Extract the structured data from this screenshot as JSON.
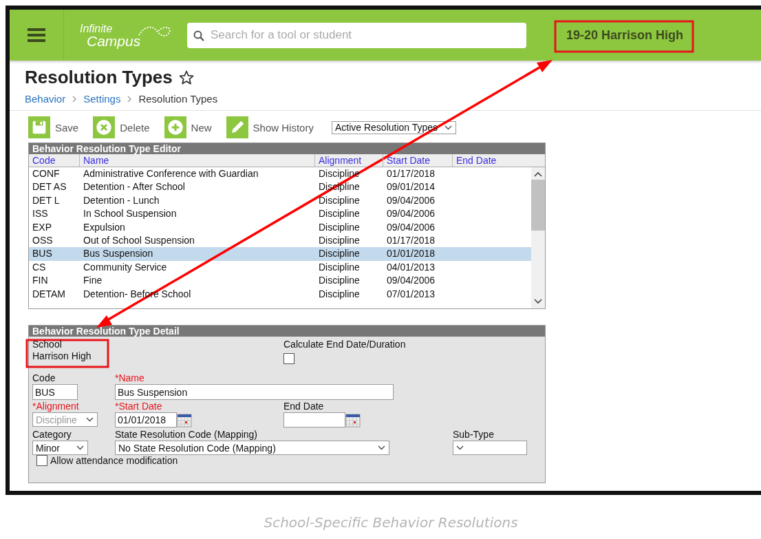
{
  "header": {
    "logo": {
      "line1": "Infinite",
      "line2": "Campus"
    },
    "search": {
      "placeholder": "Search for a tool or student"
    },
    "context": "19-20 Harrison High"
  },
  "page": {
    "title": "Resolution Types",
    "breadcrumb": [
      {
        "label": "Behavior",
        "link": true
      },
      {
        "label": "Settings",
        "link": true
      },
      {
        "label": "Resolution Types",
        "link": false
      }
    ]
  },
  "toolbar": {
    "buttons": [
      {
        "kind": "save",
        "label": "Save"
      },
      {
        "kind": "delete",
        "label": "Delete"
      },
      {
        "kind": "new",
        "label": "New"
      },
      {
        "kind": "history",
        "label": "Show History"
      }
    ],
    "filter": "Active Resolution Types"
  },
  "editor": {
    "title": "Behavior Resolution Type Editor",
    "columns": [
      "Code",
      "Name",
      "Alignment",
      "Start Date",
      "End Date"
    ],
    "rows": [
      {
        "cells": [
          "CONF",
          "Administrative Conference with Guardian",
          "Discipline",
          "01/17/2018"
        ],
        "selected": false
      },
      {
        "cells": [
          "DET AS",
          "Detention - After School",
          "Discipline",
          "09/01/2014"
        ],
        "selected": false
      },
      {
        "cells": [
          "DET L",
          "Detention - Lunch",
          "Discipline",
          "09/04/2006"
        ],
        "selected": false
      },
      {
        "cells": [
          "ISS",
          "In School Suspension",
          "Discipline",
          "09/04/2006"
        ],
        "selected": false
      },
      {
        "cells": [
          "EXP",
          "Expulsion",
          "Discipline",
          "09/04/2006"
        ],
        "selected": false
      },
      {
        "cells": [
          "OSS",
          "Out of School Suspension",
          "Discipline",
          "01/17/2018"
        ],
        "selected": false
      },
      {
        "cells": [
          "BUS",
          "Bus Suspension",
          "Discipline",
          "01/01/2018"
        ],
        "selected": true
      },
      {
        "cells": [
          "CS",
          "Community Service",
          "Discipline",
          "04/01/2013"
        ],
        "selected": false
      },
      {
        "cells": [
          "FIN",
          "Fine",
          "Discipline",
          "09/04/2006"
        ],
        "selected": false
      },
      {
        "cells": [
          "DETAM",
          "Detention- Before School",
          "Discipline",
          "07/01/2013"
        ],
        "selected": false
      }
    ]
  },
  "detail": {
    "title": "Behavior Resolution Type Detail",
    "school": {
      "label": "School",
      "value": "Harrison High"
    },
    "calculate": {
      "label": "Calculate End Date/Duration",
      "checked": false
    },
    "code": {
      "label": "Code",
      "value": "BUS",
      "required": false
    },
    "name": {
      "label": "*Name",
      "value": "Bus Suspension",
      "required": true
    },
    "alignment": {
      "label": "*Alignment",
      "value": "Discipline",
      "required": true,
      "disabled": true
    },
    "start_date": {
      "label": "*Start Date",
      "value": "01/01/2018",
      "required": true
    },
    "end_date": {
      "label": "End Date",
      "required": false
    },
    "category": {
      "label": "Category",
      "value": "Minor",
      "required": false
    },
    "state_code": {
      "label": "State Resolution Code (Mapping)",
      "value": "No State Resolution Code (Mapping)",
      "required": false
    },
    "sub_type": {
      "label": "Sub-Type",
      "required": false
    },
    "allow_attendance": {
      "label": "Allow attendance modification",
      "checked": false
    }
  },
  "caption": "School-Specific Behavior Resolutions"
}
